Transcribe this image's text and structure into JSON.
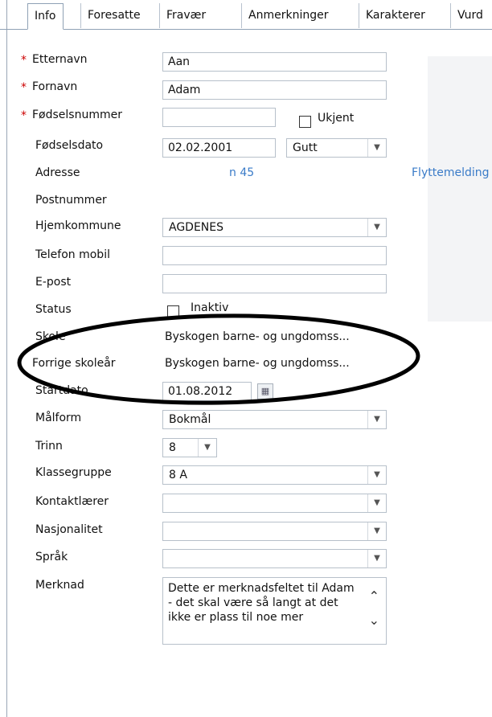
{
  "tabs": [
    "Info",
    "Foresatte",
    "Fravær",
    "Anmerkninger",
    "Karakterer",
    "Vurd"
  ],
  "fields": {
    "etternavn": {
      "label": "Etternavn",
      "value": "Aan"
    },
    "fornavn": {
      "label": "Fornavn",
      "value": "Adam"
    },
    "fodselsnummer": {
      "label": "Fødselsnummer",
      "value": "",
      "unknown_label": "Ukjent"
    },
    "fodselsdato": {
      "label": "Fødselsdato",
      "value": "02.02.2001",
      "gender": "Gutt"
    },
    "adresse": {
      "label": "Adresse",
      "value": "n 45",
      "move_link": "Flyttemelding"
    },
    "postnummer": {
      "label": "Postnummer",
      "value": ""
    },
    "hjemkommune": {
      "label": "Hjemkommune",
      "value": "AGDENES"
    },
    "telefon": {
      "label": "Telefon mobil",
      "value": ""
    },
    "epost": {
      "label": "E-post",
      "value": ""
    },
    "status": {
      "label": "Status",
      "option": "Inaktiv"
    },
    "skole": {
      "label": "Skole",
      "value": "Byskogen barne- og ungdomss..."
    },
    "forrige": {
      "label": "Forrige skoleår",
      "value": "Byskogen barne- og ungdomss..."
    },
    "startdato": {
      "label": "Startdato",
      "value": "01.08.2012"
    },
    "malform": {
      "label": "Målform",
      "value": "Bokmål"
    },
    "trinn": {
      "label": "Trinn",
      "value": "8"
    },
    "klassegruppe": {
      "label": "Klassegruppe",
      "value": "8 A"
    },
    "kontaktlaerer": {
      "label": "Kontaktlærer",
      "value": ""
    },
    "nasjonalitet": {
      "label": "Nasjonalitet",
      "value": ""
    },
    "sprak": {
      "label": "Språk",
      "value": ""
    },
    "merknad": {
      "label": "Merknad",
      "value": "Dette er merknadsfeltet til Adam - det skal være så langt at det ikke er plass til noe mer"
    }
  },
  "required_mark": "*",
  "colors": {
    "link": "#3a7bc8",
    "required": "#cc0000",
    "annotation": "#000000"
  }
}
